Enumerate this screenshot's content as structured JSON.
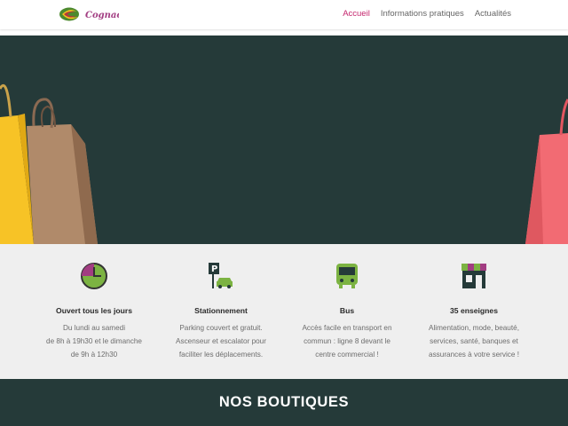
{
  "header": {
    "logo": {
      "name": "Cognac logo",
      "icon": "logo-swoosh"
    },
    "logo_text": "Cognac",
    "nav": [
      {
        "label": "Accueil",
        "active": true
      },
      {
        "label": "Informations pratiques",
        "active": false
      },
      {
        "label": "Actualités",
        "active": false
      }
    ]
  },
  "colors": {
    "accent": "#c4256d",
    "dark_green": "#253a39",
    "light_gray": "#efefef",
    "icon_green": "#7cb342",
    "icon_purple": "#a23d82"
  },
  "features": [
    {
      "icon": "clock-icon",
      "title": "Ouvert tous les jours",
      "lines": [
        "Du lundi au samedi",
        "de 8h à 19h30 et le dimanche",
        "de 9h à 12h30"
      ]
    },
    {
      "icon": "parking-icon",
      "title": "Stationnement",
      "lines": [
        "Parking couvert et gratuit.",
        "Ascenseur et escalator pour",
        "faciliter les déplacements."
      ]
    },
    {
      "icon": "bus-icon",
      "title": "Bus",
      "lines": [
        "Accès facile en transport en",
        "commun : ligne 8 devant le",
        "centre commercial !"
      ]
    },
    {
      "icon": "shop-icon",
      "title": "35 enseignes",
      "lines": [
        "Alimentation, mode, beauté,",
        "services, santé, banques et",
        "assurances à votre service !"
      ]
    }
  ],
  "section": {
    "title": "NOS BOUTIQUES"
  }
}
